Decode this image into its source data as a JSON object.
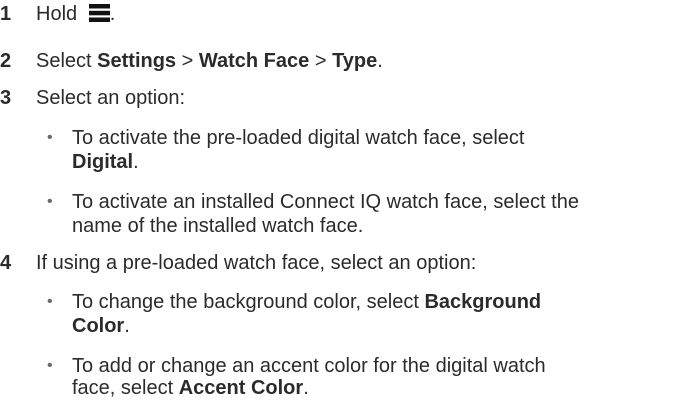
{
  "steps": [
    {
      "number": "1",
      "text_before_icon": "Hold ",
      "icon": "menu-icon",
      "text_after_icon": "."
    },
    {
      "number": "2",
      "prefix": "Select ",
      "path": [
        "Settings",
        "Watch Face",
        "Type"
      ],
      "separator": " > ",
      "suffix": "."
    },
    {
      "number": "3",
      "text": "Select an option:",
      "bullets": [
        {
          "line1": "To activate the pre-loaded digital watch face, select",
          "bold": "Digital",
          "end": "."
        },
        {
          "line1": "To activate an installed Connect IQ watch face, select the",
          "line2": "name of the installed watch face."
        }
      ]
    },
    {
      "number": "4",
      "text": "If using a pre-loaded watch face, select an option:",
      "bullets": [
        {
          "line1_prefix": "To change the background color, select ",
          "bold1": "Background",
          "bold2": "Color",
          "end": "."
        },
        {
          "line1": "To add or change an accent color for the digital watch",
          "line2_prefix": "face, select ",
          "bold": "Accent Color",
          "end": "."
        }
      ]
    }
  ],
  "bullet_glyph": "•",
  "colors": {
    "text": "#2b2b2b",
    "bullet": "#6a6a6a"
  }
}
